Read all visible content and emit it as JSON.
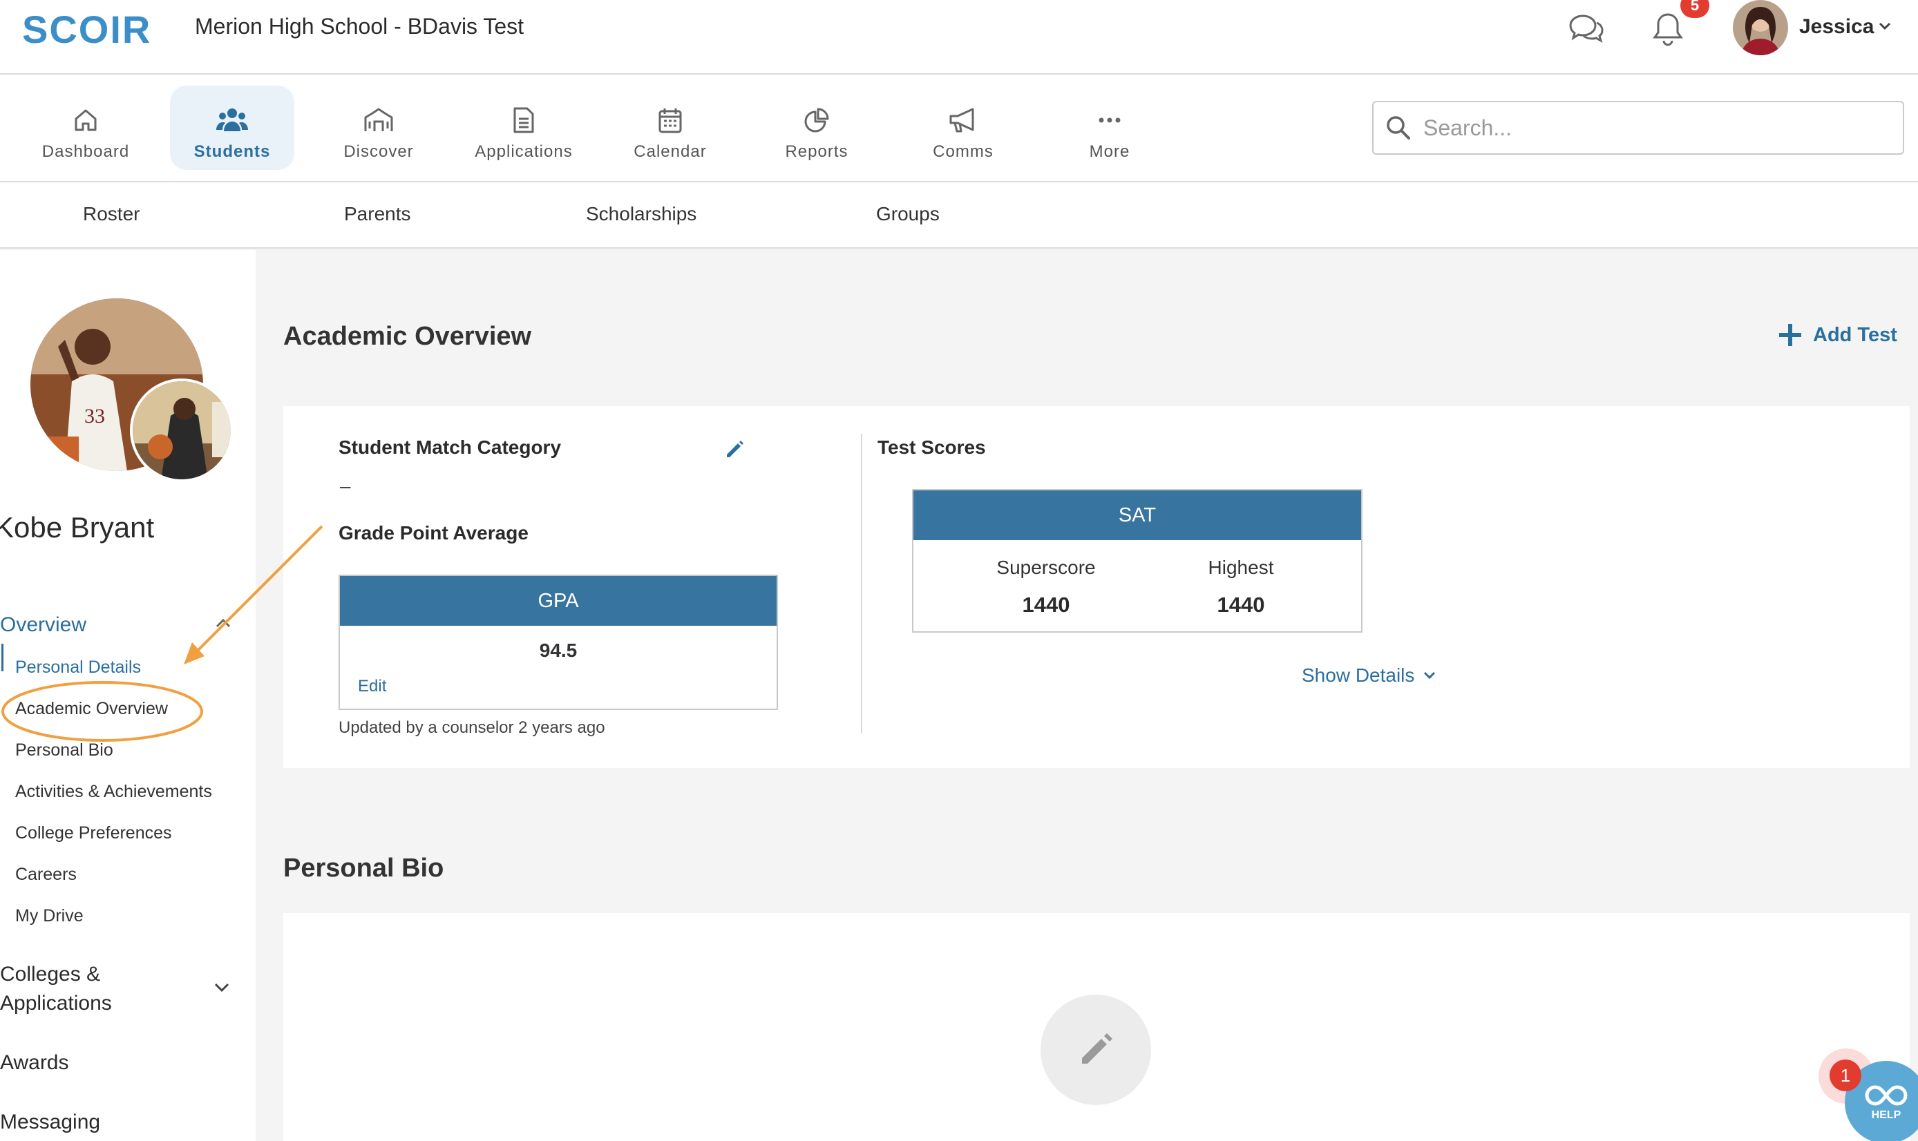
{
  "app": {
    "logo_text": "SCOIR",
    "school_name": "Merion High School - BDavis Test",
    "notification_count": "5",
    "user_name": "Jessica"
  },
  "nav": {
    "items": [
      {
        "label": "Dashboard",
        "icon": "house-icon"
      },
      {
        "label": "Students",
        "icon": "people-icon"
      },
      {
        "label": "Discover",
        "icon": "building-icon"
      },
      {
        "label": "Applications",
        "icon": "document-icon"
      },
      {
        "label": "Calendar",
        "icon": "calendar-icon"
      },
      {
        "label": "Reports",
        "icon": "pie-chart-icon"
      },
      {
        "label": "Comms",
        "icon": "megaphone-icon"
      },
      {
        "label": "More",
        "icon": "ellipsis-icon"
      }
    ],
    "active": "Students"
  },
  "search": {
    "placeholder": "Search..."
  },
  "subnav": {
    "items": [
      "Roster",
      "Parents",
      "Scholarships",
      "Groups"
    ]
  },
  "sidebar": {
    "student_name": "Kobe Bryant",
    "overview_label": "Overview",
    "links": [
      "Personal Details",
      "Academic Overview",
      "Personal Bio",
      "Activities & Achievements",
      "College Preferences",
      "Careers",
      "My Drive"
    ],
    "sections": [
      "Colleges & Applications",
      "Awards",
      "Messaging"
    ]
  },
  "main": {
    "academic_title": "Academic Overview",
    "add_test_label": "Add Test",
    "match_category_label": "Student Match Category",
    "match_category_value": "–",
    "gpa_section_label": "Grade Point Average",
    "gpa_header": "GPA",
    "gpa_value": "94.5",
    "gpa_edit": "Edit",
    "updated_text": "Updated by a counselor 2 years ago",
    "test_scores_label": "Test Scores",
    "sat_header": "SAT",
    "superscore_label": "Superscore",
    "superscore_value": "1440",
    "highest_label": "Highest",
    "highest_value": "1440",
    "show_details": "Show Details",
    "bio_title": "Personal Bio"
  },
  "help": {
    "label": "HELP",
    "badge": "1"
  },
  "colors": {
    "accent": "#2a6f9e",
    "header_blue": "#3874a0",
    "annotation": "#f0a040",
    "badge": "#e23c30"
  }
}
